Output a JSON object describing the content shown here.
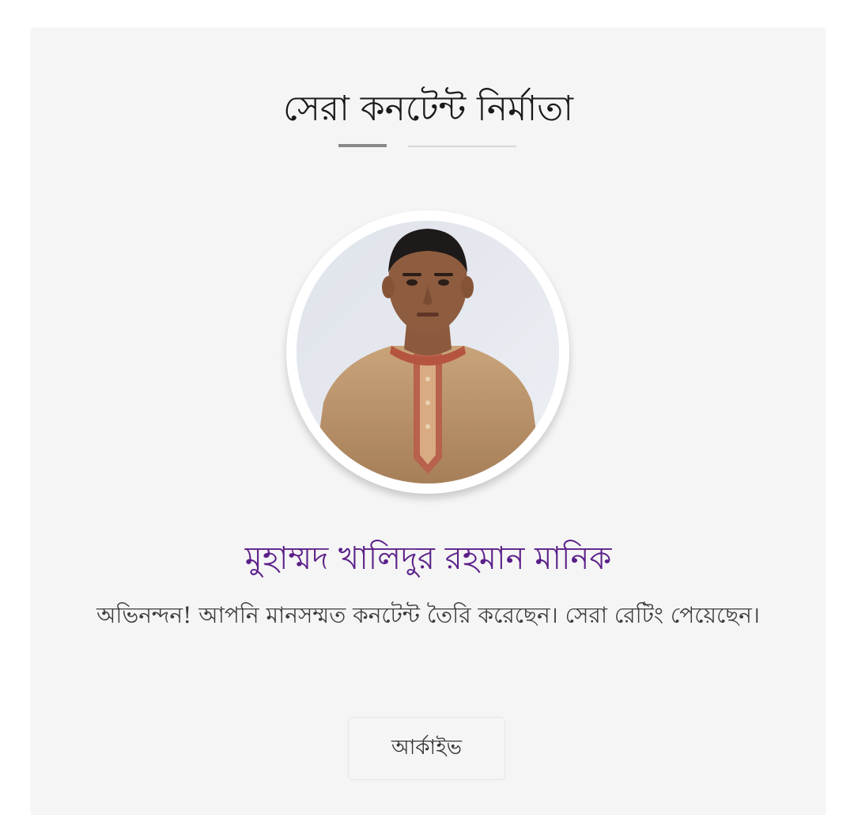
{
  "card": {
    "title": "সেরা কনটেন্ট নির্মাতা",
    "name": "মুহাম্মদ খালিদুর রহমান মানিক",
    "message": "অভিনন্দন! আপনি মানসম্মত কনটেন্ট তৈরি করেছেন। সেরা রেটিং পেয়েছেন।",
    "archive_label": "আর্কাইভ"
  },
  "colors": {
    "card_background": "#f5f5f5",
    "name_accent": "#5b1f88",
    "text": "#3a3a3a"
  },
  "icons": {
    "avatar": "profile-photo"
  }
}
